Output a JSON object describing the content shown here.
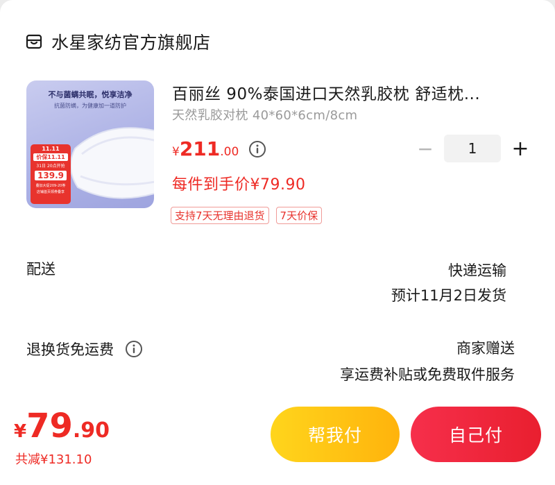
{
  "store": {
    "name": "水星家纺官方旗舰店",
    "icon": "store-icon"
  },
  "product": {
    "image": {
      "headline": "不与菌螨共眠，悦享洁净",
      "subline": "抗菌防螨，为健康加一道防护",
      "promo": {
        "badge": "11.11",
        "price_label": "价保11.11",
        "date": "31日 20点开抢",
        "price": "139.9",
        "line1": "叠加大促209-20券",
        "line2": "店铺首页领券叠享"
      }
    },
    "title": "百丽丝 90%泰国进口天然乳胶枕 舒适枕...",
    "spec": "天然乳胶对枕 40*60*6cm/8cm",
    "price": {
      "symbol": "¥",
      "integer": "211",
      "decimal": ".00"
    },
    "final_price": "每件到手价¥79.90",
    "quantity": "1",
    "tags": [
      "支持7天无理由退货",
      "7天价保"
    ]
  },
  "delivery": {
    "label": "配送",
    "method": "快递运输",
    "date": "预计11月2日发货"
  },
  "returns": {
    "label": "退换货免运费",
    "provider": "商家赠送",
    "desc": "享运费补贴或免费取件服务"
  },
  "footer": {
    "total": {
      "symbol": "¥",
      "integer": "79",
      "decimal": ".90"
    },
    "saved": "共减¥131.10",
    "help_pay": "帮我付",
    "self_pay": "自己付"
  },
  "colors": {
    "accent": "#ee2a24",
    "help_button": "#ffc417",
    "self_button": "#f0283e"
  }
}
